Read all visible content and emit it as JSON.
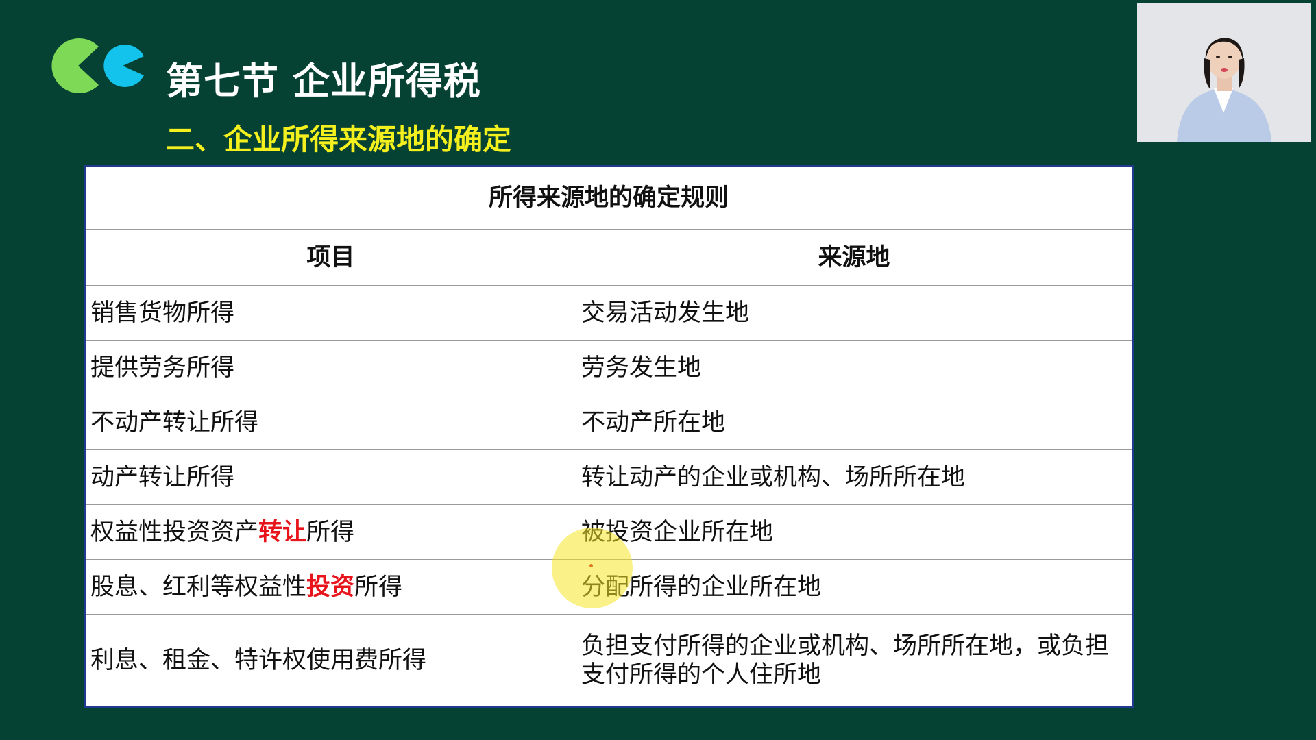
{
  "header": {
    "section_title": "第七节 企业所得税",
    "subsection_title": "二、企业所得来源地的确定"
  },
  "table": {
    "caption": "所得来源地的确定规则",
    "columns": [
      "项目",
      "来源地"
    ],
    "rows": [
      {
        "item": "销售货物所得",
        "source": "交易活动发生地"
      },
      {
        "item": "提供劳务所得",
        "source": "劳务发生地"
      },
      {
        "item": "不动产转让所得",
        "source": "不动产所在地"
      },
      {
        "item": "动产转让所得",
        "source": "转让动产的企业或机构、场所所在地"
      },
      {
        "item_before": "权益性投资资产",
        "item_highlight": "转让",
        "item_after": "所得",
        "source": "被投资企业所在地"
      },
      {
        "item_before": "股息、红利等权益性",
        "item_highlight": "投资",
        "item_after": "所得",
        "source": "分配所得的企业所在地"
      },
      {
        "item": "利息、租金、特许权使用费所得",
        "source": "负担支付所得的企业或机构、场所所在地，或负担支付所得的个人住所地"
      }
    ]
  },
  "colors": {
    "background": "#064233",
    "title": "#ffffff",
    "subtitle": "#f4f01e",
    "highlight": "#e8141b",
    "table_border": "#1f3a8f",
    "logo_green": "#7ed957",
    "logo_cyan": "#14c3ec"
  },
  "icons": {
    "logo": "quote-marks-logo",
    "webcam": "presenter-webcam",
    "pointer": "laser-pointer-highlight"
  }
}
